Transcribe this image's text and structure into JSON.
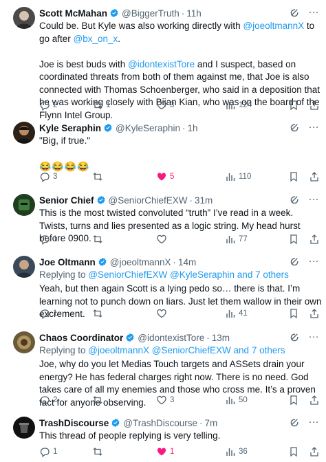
{
  "colors": {
    "accent": "#1d9bf0",
    "muted": "#536471",
    "like": "#f91880",
    "text": "#0f1419"
  },
  "tweets": [
    {
      "name": "Scott McMahan",
      "handle": "@BiggerTruth",
      "time": "11h",
      "avatar_color": "#4a4a4a",
      "text_parts": [
        [
          "Could be. But Kyle was also working directly with ",
          "@joeoltmannX",
          " to go after ",
          "@bx_on_x",
          "."
        ],
        [
          "Joe is best buds with ",
          "@idontexistTore",
          " and I suspect,  based on coordinated threats from both of them against me, that Joe is also connected with Thomas Schoenberger, who said in a deposition that he was working closely with Bijan Kian, who was on the board of the Flynn Intel Group."
        ]
      ],
      "replies": "2",
      "reposts": "1",
      "likes": "3",
      "views": "124"
    },
    {
      "name": "Kyle Seraphin",
      "handle": "@KyleSeraphin",
      "time": "1h",
      "avatar_color": "#2b2118",
      "text": "\"Big, if true.\"",
      "emoji": "😂😂😂😂",
      "replies": "3",
      "reposts": "",
      "likes": "5",
      "views": "110",
      "liked": true
    },
    {
      "name": "Senior Chief",
      "handle": "@SeniorChiefEXW",
      "time": "31m",
      "avatar_color": "#1f3d1f",
      "text": "This is the most twisted convoluted “truth” I’ve read in a week. Twists, turns and lies presented as a logic string. My head hurst before 0900.",
      "replies": "1",
      "reposts": "",
      "likes": "",
      "views": "77"
    },
    {
      "name": "Joe Oltmann",
      "handle": "@joeoltmannX",
      "time": "14m",
      "avatar_color": "#3a4a5a",
      "replying_prefix": "Replying to ",
      "replying_mentions": "@SeniorChiefEXW @KyleSeraphin and 7 others",
      "text": "Yeah, but then again Scott is a lying pedo so… there is that. I’m learning not to punch down on liars. Just let them wallow in their own excrement.",
      "replies": "1",
      "reposts": "",
      "likes": "",
      "views": "41"
    },
    {
      "name": "Chaos Coordinator",
      "handle": "@idontexistTore",
      "time": "13m",
      "avatar_color": "#6b5a3a",
      "replying_prefix": "Replying to ",
      "replying_mentions": "@joeoltmannX @SeniorChiefEXW and 7 others",
      "text": "Joe, why do you let Medias Touch targets and ASSets drain your energy? He has federal charges right now. There is no need. God takes care of all my enemies and those who cross me. It’s a proven fact for anyone observing.",
      "replies": "2",
      "reposts": "",
      "likes": "3",
      "views": "50"
    },
    {
      "name": "TrashDiscourse",
      "handle": "@TrashDiscourse",
      "time": "7m",
      "avatar_color": "#111111",
      "text": "This thread of people replying is very telling.",
      "replies": "1",
      "reposts": "",
      "likes": "1",
      "views": "36",
      "liked": true
    }
  ]
}
